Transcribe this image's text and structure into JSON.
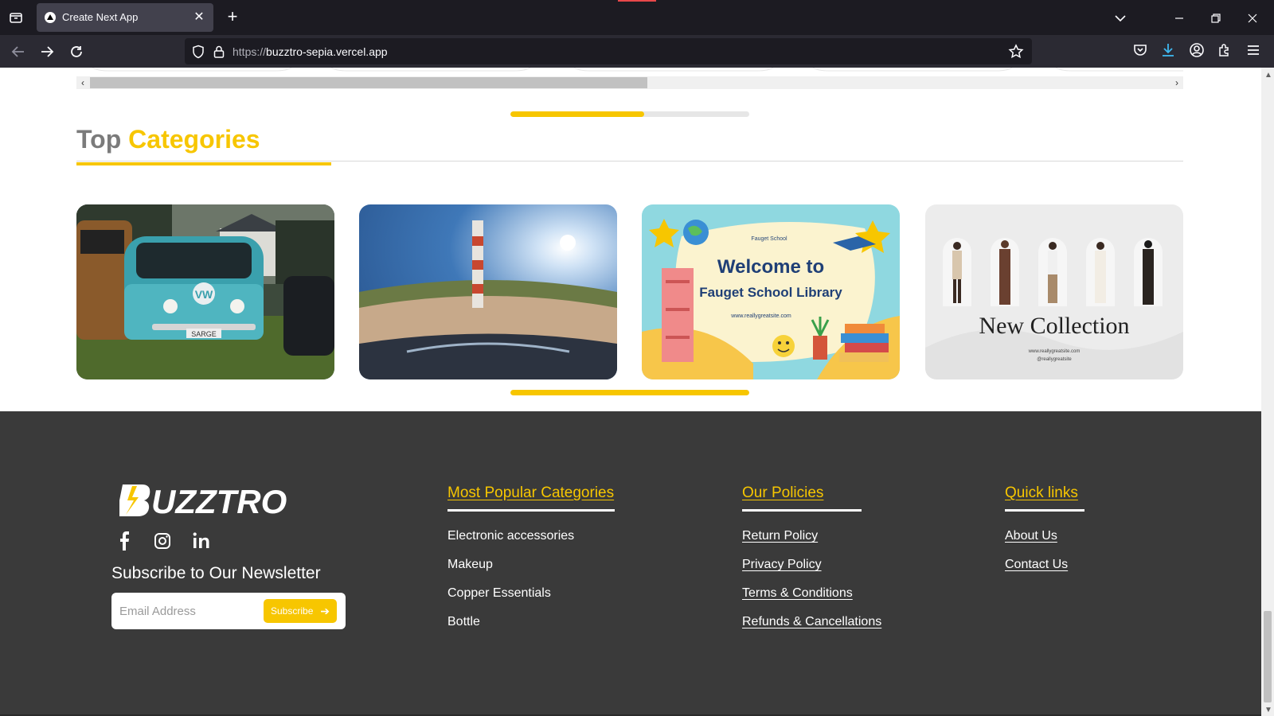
{
  "browser": {
    "tab_title": "Create Next App",
    "new_tab": "+",
    "tab_close": "✕",
    "url_protocol": "https://",
    "url_host": "buzztro-sepia.vercel.app"
  },
  "categories": {
    "title_part1": "Top ",
    "title_part2": "Categories",
    "upper_progress": 0.56,
    "lower_progress": 1.0,
    "cards": [
      {
        "name": "vw-bus-image",
        "desc": "Volkswagen bus",
        "plate": "SARGE"
      },
      {
        "name": "lighthouse-panorama-image",
        "desc": "Lighthouse panorama"
      },
      {
        "name": "school-library-image",
        "line1": "Welcome to",
        "line2": "Fauget School Library",
        "small": "www.reallygreatsite.com",
        "top": "Fauget School"
      },
      {
        "name": "new-collection-image",
        "line1": "New Collection",
        "small1": "www.reallygreatsite.com",
        "small2": "@reallygreatsite"
      }
    ]
  },
  "footer": {
    "logo": "BUZZTRO",
    "newsletter_title": "Subscribe to Our Newsletter",
    "email_placeholder": "Email Address",
    "subscribe_label": "Subscribe",
    "popular": {
      "title": "Most Popular Categories",
      "items": [
        "Electronic accessories",
        "Makeup",
        "Copper Essentials",
        "Bottle"
      ]
    },
    "policies": {
      "title": "Our Policies",
      "items": [
        "Return Policy",
        "Privacy Policy",
        "Terms & Conditions",
        "Refunds & Cancellations"
      ]
    },
    "quick": {
      "title": "Quick links",
      "items": [
        "About Us",
        "Contact Us"
      ]
    }
  },
  "colors": {
    "accent": "#f7c600",
    "footer_bg": "#3a3a3a",
    "heading_gray": "#7b7b7b"
  }
}
